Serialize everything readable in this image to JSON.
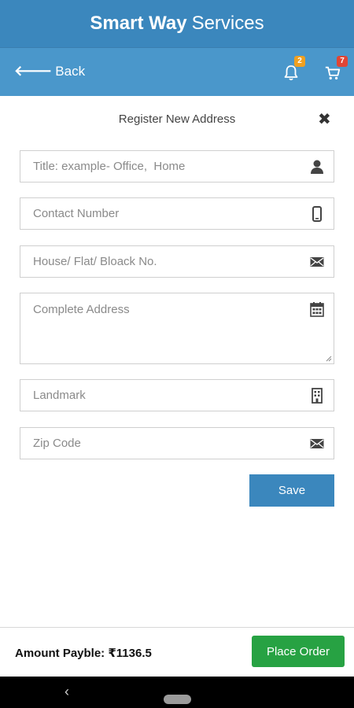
{
  "header": {
    "title_bold": "Smart Way",
    "title_light": "Services"
  },
  "nav": {
    "back_label": "Back",
    "notifications_badge": "2",
    "cart_badge": "7"
  },
  "form": {
    "title": "Register New Address",
    "close_label": "✖",
    "fields": {
      "title_placeholder": "Title: example- Office,  Home",
      "contact_placeholder": "Contact Number",
      "house_placeholder": "House/ Flat/ Bloack No.",
      "address_placeholder": "Complete Address",
      "landmark_placeholder": "Landmark",
      "zip_placeholder": "Zip Code"
    },
    "save_label": "Save"
  },
  "footer": {
    "amount_label": "Amount Payble: ₹1136.5",
    "place_order_label": "Place Order"
  },
  "system_nav": {
    "back_glyph": "‹"
  },
  "colors": {
    "header": "#3b87bd",
    "nav": "#4a97cb",
    "save_button": "#3b87bd",
    "place_order": "#27a243",
    "badge_notifications": "#f0a020",
    "badge_cart": "#e04535"
  },
  "icons": {
    "back": "arrow-left-icon",
    "notifications": "bell-icon",
    "cart": "cart-icon",
    "title_field": "user-icon",
    "contact_field": "mobile-icon",
    "house_field": "envelope-icon",
    "address_field": "calendar-icon",
    "landmark_field": "building-icon",
    "zip_field": "envelope-icon"
  }
}
